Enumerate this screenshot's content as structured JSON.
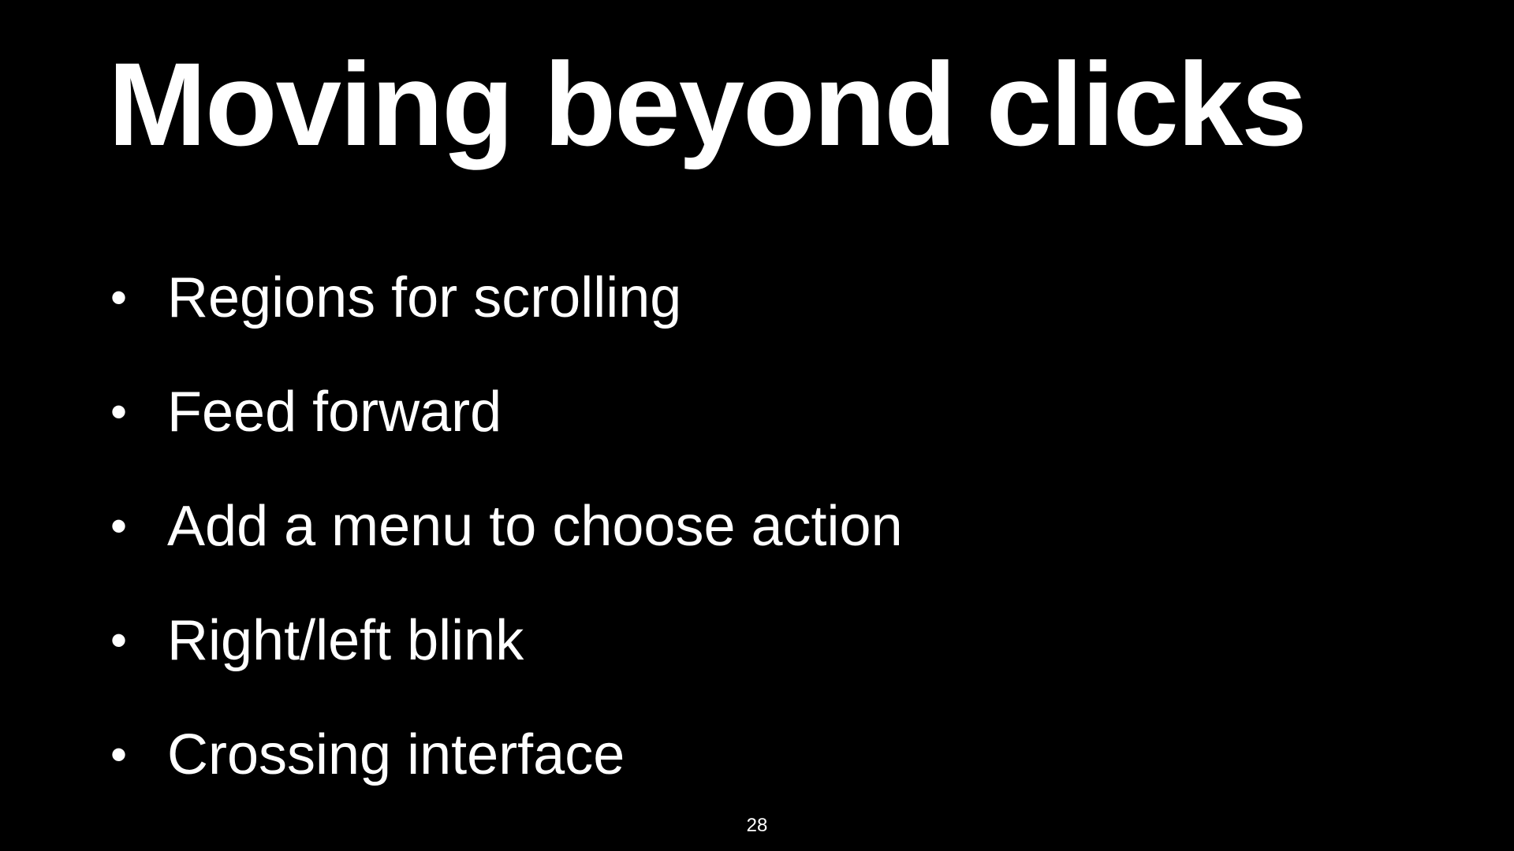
{
  "slide": {
    "title": "Moving beyond clicks",
    "bullets": [
      {
        "marker": "•",
        "text": "Regions for scrolling"
      },
      {
        "marker": "•",
        "text": "Feed forward"
      },
      {
        "marker": "•",
        "text": "Add a menu to choose action"
      },
      {
        "marker": "•",
        "text": "Right/left blink"
      },
      {
        "marker": "•",
        "text": "Crossing interface"
      }
    ],
    "page_number": "28"
  },
  "colors": {
    "background": "#000000",
    "text": "#ffffff"
  }
}
